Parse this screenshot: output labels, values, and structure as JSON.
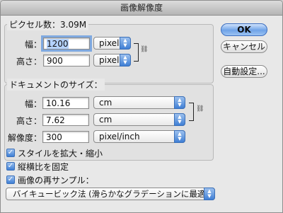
{
  "window": {
    "title": "画像解像度"
  },
  "pixel_dimensions": {
    "title": "ピクセル数：3.09M",
    "width": {
      "label": "幅：",
      "value": "1200",
      "unit": "pixel"
    },
    "height": {
      "label": "高さ：",
      "value": "900",
      "unit": "pixel"
    },
    "link_icon": "chain-link-icon"
  },
  "document_size": {
    "title": "ドキュメントのサイズ：",
    "width": {
      "label": "幅：",
      "value": "10.16",
      "unit": "cm"
    },
    "height": {
      "label": "高さ：",
      "value": "7.62",
      "unit": "cm"
    },
    "resolution": {
      "label": "解像度：",
      "value": "300",
      "unit": "pixel/inch"
    },
    "link_icon": "chain-link-icon"
  },
  "buttons": {
    "ok": "OK",
    "cancel": "キャンセル",
    "auto": "自動設定..."
  },
  "options": {
    "scale_styles": {
      "label": "スタイルを拡大・縮小",
      "checked": true
    },
    "constrain": {
      "label": "縦横比を固定",
      "checked": true
    },
    "resample": {
      "label": "画像の再サンプル：",
      "checked": true
    }
  },
  "resample_method": "バイキュービック法 (滑らかなグラデーションに最適)",
  "colors": {
    "accent": "#3f7fd5",
    "focus_ring": "#7fa9e0",
    "selection": "#b5d3ff"
  }
}
